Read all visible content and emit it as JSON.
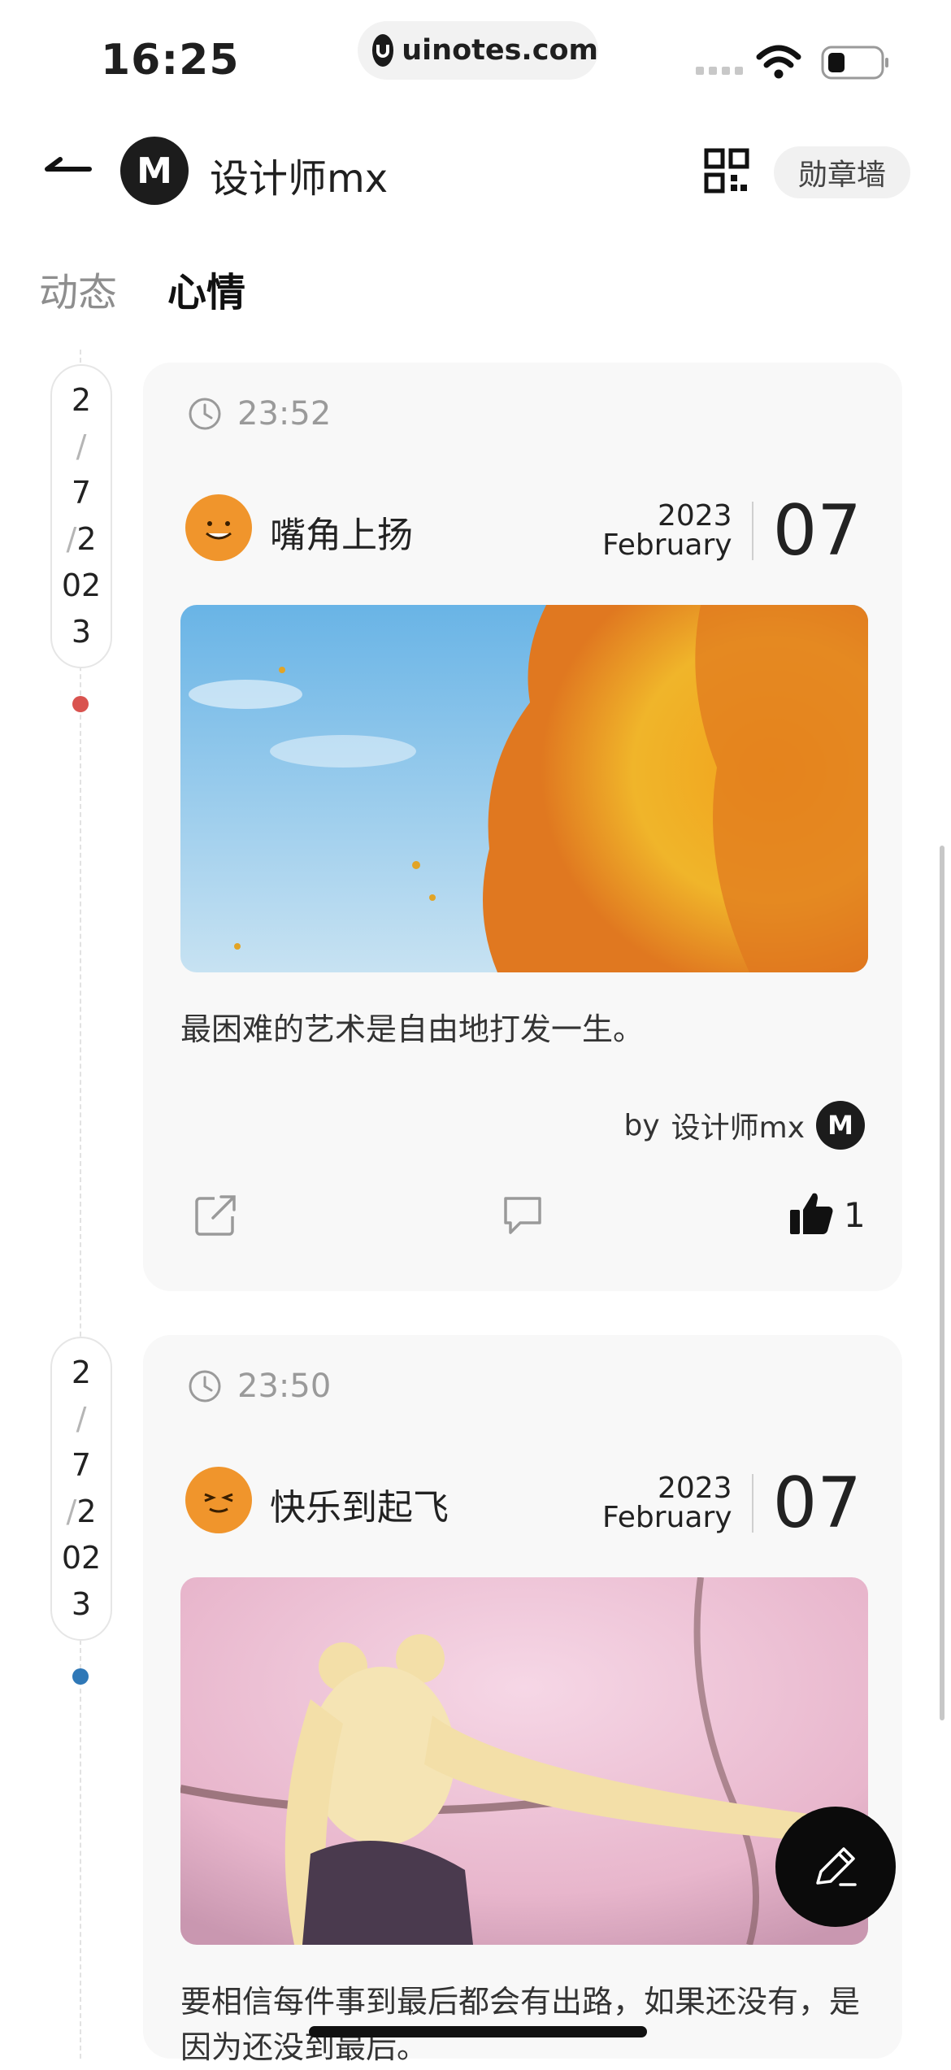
{
  "status_bar": {
    "time": "16:25",
    "url": "uinotes.com"
  },
  "header": {
    "avatar_letter": "M",
    "title": "设计师mx",
    "badge_wall": "勋章墙"
  },
  "tabs": [
    {
      "label": "动态"
    },
    {
      "label": "心情"
    }
  ],
  "posts": [
    {
      "date_pill": {
        "d": "2",
        "sep1": "/",
        "m": "7",
        "sep2": "/",
        "y1": "2",
        "y2": "02",
        "y3": "3"
      },
      "dot_color": "#d9534f",
      "time": "23:52",
      "mood": "嘴角上扬",
      "year": "2023",
      "month": "February",
      "day": "07",
      "text": "最困难的艺术是自由地打发一生。",
      "by_prefix": "by",
      "author": "设计师mx",
      "like_count": "1"
    },
    {
      "date_pill": {
        "d": "2",
        "sep1": "/",
        "m": "7",
        "sep2": "/",
        "y1": "2",
        "y2": "02",
        "y3": "3"
      },
      "dot_color": "#2f78b7",
      "time": "23:50",
      "mood": "快乐到起飞",
      "year": "2023",
      "month": "February",
      "day": "07",
      "text": "要相信每件事到最后都会有出路，如果还没有，是因为还没到最后。"
    }
  ]
}
